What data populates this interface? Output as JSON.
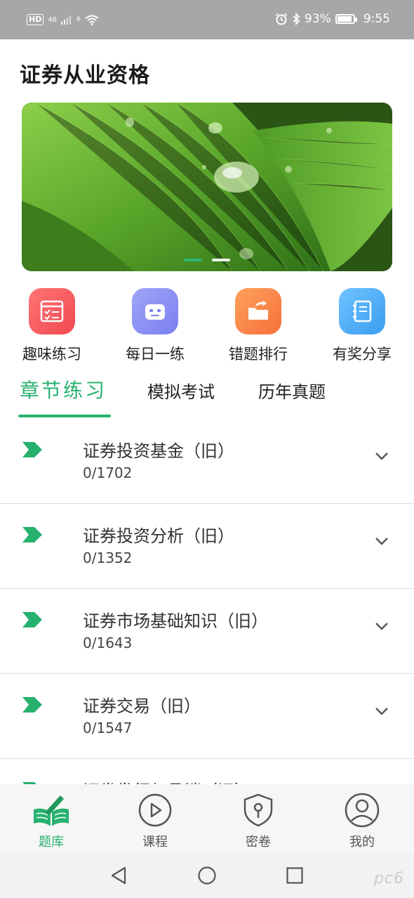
{
  "status_bar": {
    "hd": "HD",
    "network": "46",
    "wifi_sub": "6",
    "battery": "93%",
    "time": "9:55"
  },
  "page_title": "证券从业资格",
  "banner": {
    "slides": 2,
    "active_index": 0
  },
  "quick_menu": [
    {
      "label": "趣味练习",
      "icon": "checklist-icon",
      "color": "#f5595c"
    },
    {
      "label": "每日一练",
      "icon": "robot-face-icon",
      "color": "#8a90f3"
    },
    {
      "label": "错题排行",
      "icon": "folder-share-icon",
      "color": "#fb8a4c"
    },
    {
      "label": "有奖分享",
      "icon": "notebook-icon",
      "color": "#4ab0f5"
    }
  ],
  "tabs": [
    {
      "label": "章节练习",
      "active": true
    },
    {
      "label": "模拟考试",
      "active": false
    },
    {
      "label": "历年真题",
      "active": false
    }
  ],
  "chapters": [
    {
      "title": "证券投资基金（旧）",
      "count": "0/1702"
    },
    {
      "title": "证券投资分析（旧）",
      "count": "0/1352"
    },
    {
      "title": "证券市场基础知识（旧）",
      "count": "0/1643"
    },
    {
      "title": "证券交易（旧）",
      "count": "0/1547"
    },
    {
      "title": "证券发行与承销（旧）",
      "count": ""
    }
  ],
  "bottom_nav": [
    {
      "label": "题库",
      "icon": "book-pen-icon",
      "active": true
    },
    {
      "label": "课程",
      "icon": "play-circle-icon",
      "active": false
    },
    {
      "label": "密卷",
      "icon": "shield-lock-icon",
      "active": false
    },
    {
      "label": "我的",
      "icon": "user-circle-icon",
      "active": false
    }
  ],
  "watermark": "pc6",
  "colors": {
    "accent": "#27b16f",
    "status_bar": "#a7a7a7"
  }
}
